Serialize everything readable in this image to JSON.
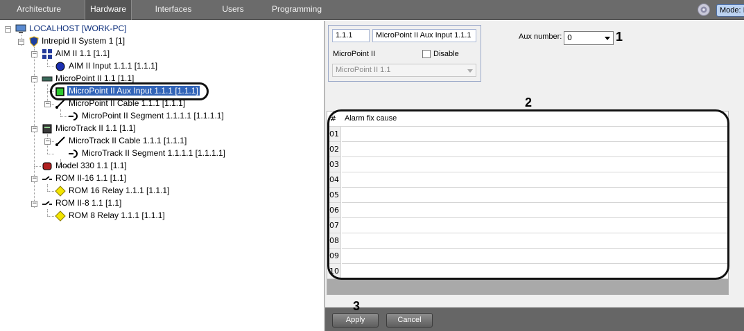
{
  "top_tabs": [
    "Architecture",
    "Hardware",
    "Interfaces",
    "Users",
    "Programming"
  ],
  "active_tab": "Hardware",
  "mode_label": "Mode: I",
  "tree": {
    "root": "LOCALHOST [WORK-PC]",
    "system": "Intrepid II System 1 [1]",
    "aim": "AIM II 1.1 [1.1]",
    "aim_input": "AIM II Input 1.1.1 [1.1.1]",
    "micropoint": "MicroPoint II 1.1 [1.1]",
    "mp_aux_input": "MicroPoint II Aux Input 1.1.1 [1.1.1]",
    "mp_cable": "MicroPoint II Cable 1.1.1 [1.1.1]",
    "mp_segment": "MicroPoint II Segment 1.1.1.1 [1.1.1.1]",
    "microtrack": "MicroTrack II 1.1 [1.1]",
    "mt_cable": "MicroTrack II Cable 1.1.1 [1.1.1]",
    "mt_segment": "MicroTrack II Segment 1.1.1.1 [1.1.1.1]",
    "model330": "Model 330 1.1 [1.1]",
    "rom16": "ROM II-16 1.1 [1.1]",
    "rom16_relay": "ROM 16 Relay 1.1.1 [1.1.1]",
    "rom8": "ROM II-8 1.1 [1.1]",
    "rom8_relay": "ROM 8 Relay 1.1.1 [1.1.1]"
  },
  "object": {
    "id": "1.1.1",
    "name": "MicroPoint II Aux Input 1.1.1",
    "parent_label": "MicroPoint II",
    "disable_label": "Disable",
    "parent_value": "MicroPoint II 1.1"
  },
  "aux": {
    "label": "Aux number:",
    "value": "0"
  },
  "callouts": [
    "1",
    "2",
    "3"
  ],
  "table": {
    "col_num": "#",
    "col_cause": "Alarm fix cause",
    "rows": [
      "01",
      "02",
      "03",
      "04",
      "05",
      "06",
      "07",
      "08",
      "09",
      "10"
    ]
  },
  "buttons": {
    "apply": "Apply",
    "cancel": "Cancel"
  },
  "colors": {
    "topbar": "#6b6b6b",
    "selection": "#3264b8",
    "panel": "#f0f0f0"
  }
}
